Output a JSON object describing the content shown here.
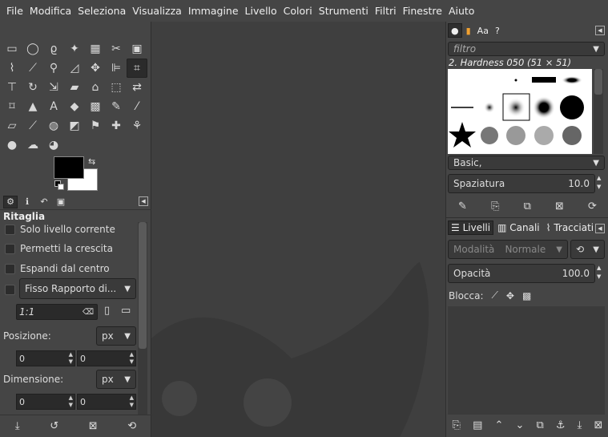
{
  "menubar": [
    "File",
    "Modifica",
    "Seleziona",
    "Visualizza",
    "Immagine",
    "Livello",
    "Colori",
    "Strumenti",
    "Filtri",
    "Finestre",
    "Aiuto"
  ],
  "toolbox": {
    "tools": [
      {
        "name": "rect-select-icon",
        "glyph": "▭"
      },
      {
        "name": "ellipse-select-icon",
        "glyph": "◯"
      },
      {
        "name": "free-select-icon",
        "glyph": "ϱ"
      },
      {
        "name": "fuzzy-select-icon",
        "glyph": "✦"
      },
      {
        "name": "select-by-color-icon",
        "glyph": "▦"
      },
      {
        "name": "scissors-icon",
        "glyph": "✂"
      },
      {
        "name": "foreground-select-icon",
        "glyph": "▣"
      },
      {
        "name": "paths-icon",
        "glyph": "⌇"
      },
      {
        "name": "color-picker-icon",
        "glyph": "⟋"
      },
      {
        "name": "zoom-icon",
        "glyph": "⚲"
      },
      {
        "name": "measure-icon",
        "glyph": "◿"
      },
      {
        "name": "move-icon",
        "glyph": "✥"
      },
      {
        "name": "align-icon",
        "glyph": "⊫"
      },
      {
        "name": "crop-icon",
        "glyph": "⌗"
      },
      {
        "name": "unified-transform-icon",
        "glyph": "⊤"
      },
      {
        "name": "rotate-icon",
        "glyph": "↻"
      },
      {
        "name": "scale-icon",
        "glyph": "⇲"
      },
      {
        "name": "shear-icon",
        "glyph": "▰"
      },
      {
        "name": "cage-transform-icon",
        "glyph": "⌂"
      },
      {
        "name": "perspective-icon",
        "glyph": "⬚"
      },
      {
        "name": "flip-icon",
        "glyph": "⇄"
      },
      {
        "name": "warp-icon",
        "glyph": "⌑"
      },
      {
        "name": "handle-transform-icon",
        "glyph": "▲"
      },
      {
        "name": "text-icon",
        "glyph": "A"
      },
      {
        "name": "bucket-fill-icon",
        "glyph": "◆"
      },
      {
        "name": "pattern-icon",
        "glyph": "▩"
      },
      {
        "name": "pencil-icon",
        "glyph": "✎"
      },
      {
        "name": "paintbrush-icon",
        "glyph": "⁄"
      },
      {
        "name": "eraser-icon",
        "glyph": "▱"
      },
      {
        "name": "airbrush-icon",
        "glyph": "⟋"
      },
      {
        "name": "ink-icon",
        "glyph": "◍"
      },
      {
        "name": "gradient-icon",
        "glyph": "◩"
      },
      {
        "name": "clone-icon",
        "glyph": "⚑"
      },
      {
        "name": "heal-icon",
        "glyph": "✚"
      },
      {
        "name": "perspective-clone-icon",
        "glyph": "⚘"
      },
      {
        "name": "blur-icon",
        "glyph": "●"
      },
      {
        "name": "smudge-icon",
        "glyph": "☁"
      },
      {
        "name": "dodge-burn-icon",
        "glyph": "◕"
      }
    ],
    "active_index": 13
  },
  "tool_options": {
    "title": "Ritaglia",
    "checkbox_current_layer": "Solo livello corrente",
    "checkbox_allow_growing": "Permetti la crescita",
    "checkbox_expand_center": "Espandi dal centro",
    "fixed_combo": "Fisso Rapporto di...",
    "ratio_value": "1:1",
    "position_label": "Posizione:",
    "position_unit": "px",
    "position_x": "0",
    "position_y": "0",
    "size_label": "Dimensione:",
    "size_unit": "px",
    "size_w": "0",
    "size_h": "0"
  },
  "brushes": {
    "filter_placeholder": "filtro",
    "selected_name": "2. Hardness 050 (51 × 51)",
    "preset": "Basic,",
    "spacing_label": "Spaziatura",
    "spacing_value": "10.0"
  },
  "layers": {
    "tab_layers": "Livelli",
    "tab_channels": "Canali",
    "tab_paths": "Tracciati",
    "mode_label": "Modalità",
    "mode_value": "Normale",
    "opacity_label": "Opacità",
    "opacity_value": "100.0",
    "lock_label": "Blocca:"
  },
  "colors": {
    "foreground": "#000000",
    "background": "#ffffff"
  }
}
